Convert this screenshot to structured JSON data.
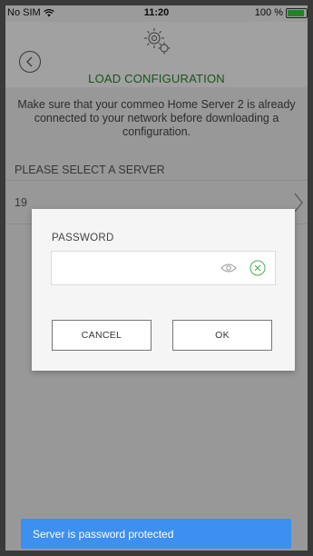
{
  "status_bar": {
    "carrier": "No SIM",
    "time": "11:20",
    "battery": "100 %",
    "battery_level": 1.0
  },
  "header": {
    "title": "LOAD CONFIGURATION",
    "icon": "gear-icon",
    "back_icon": "back-icon"
  },
  "content": {
    "intro": "Make sure that your commeo Home Server 2 is already connected to your network before downloading a configuration.",
    "section_label": "PLEASE SELECT A SERVER",
    "server_item": "19"
  },
  "dialog": {
    "password_label": "PASSWORD",
    "password_value": "",
    "cancel_label": "CANCEL",
    "ok_label": "OK"
  },
  "toast": {
    "message": "Server is password protected",
    "color": "#3d8ff0"
  },
  "colors": {
    "accent_green": "#2e7d32",
    "toast_blue": "#3d8ff0"
  }
}
